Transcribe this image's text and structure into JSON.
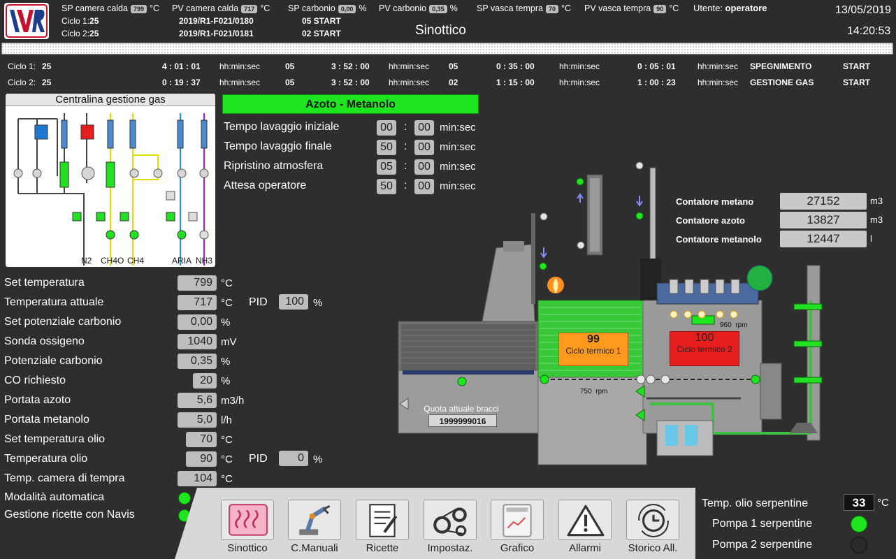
{
  "header": {
    "sp_camera_calda_label": "SP camera calda",
    "sp_camera_calda": "799",
    "sp_camera_calda_unit": "°C",
    "pv_camera_calda_label": "PV camera calda",
    "pv_camera_calda": "717",
    "pv_camera_calda_unit": "°C",
    "sp_carbonio_label": "SP carbonio",
    "sp_carbonio": "0,00",
    "sp_carbonio_unit": "%",
    "pv_carbonio_label": "PV carbonio",
    "pv_carbonio": "0,35",
    "pv_carbonio_unit": "%",
    "sp_vasca_label": "SP vasca tempra",
    "sp_vasca": "70",
    "sp_vasca_unit": "°C",
    "pv_vasca_label": "PV vasca tempra",
    "pv_vasca": "90",
    "pv_vasca_unit": "°C",
    "utente_label": "Utente:",
    "utente": "operatore",
    "date": "13/05/2019",
    "time": "14:20:53",
    "page_title": "Sinottico",
    "ciclo1_label": "Ciclo 1:",
    "ciclo1_num": "25",
    "ciclo1_code": "2019/R1-F021/0180",
    "ciclo1_step": "05  START",
    "ciclo2_label": "Ciclo 2:",
    "ciclo2_num": "25",
    "ciclo2_code": "2019/R1-F021/0181",
    "ciclo2_step": "02  START",
    "logo_text": "IVR"
  },
  "cycles": [
    {
      "label": "Ciclo 1:",
      "num": "25",
      "t1": "4 :  01 :  01",
      "u1": "hh:min:sec",
      "s1": "05",
      "t2": "3 :  52 :  00",
      "u2": "hh:min:sec",
      "s2": "05",
      "t3": "0 :  35 :  00",
      "u3": "hh:min:sec",
      "t4": "0 :  05 :  01",
      "u4": "hh:min:sec",
      "phase": "SPEGNIMENTO",
      "state": "START"
    },
    {
      "label": "Ciclo 2:",
      "num": "25",
      "t1": "0 :  19 :  37",
      "u1": "hh:min:sec",
      "s1": "05",
      "t2": "3 :  52 :  00",
      "u2": "hh:min:sec",
      "s2": "02",
      "t3": "1 :  15 :  00",
      "u3": "hh:min:sec",
      "t4": "1 :  00 :  23",
      "u4": "hh:min:sec",
      "phase": "GESTIONE GAS",
      "state": "START"
    }
  ],
  "gas_panel": {
    "title": "Centralina gestione gas",
    "lines": [
      "N2",
      "CH4O",
      "CH4",
      "ARIA",
      "NH3"
    ]
  },
  "gas_mode": "Azoto - Metanolo",
  "timers": [
    {
      "label": "Tempo lavaggio iniziale",
      "a": "00",
      "b": "00",
      "unit": "min:sec"
    },
    {
      "label": "Tempo lavaggio finale",
      "a": "50",
      "b": "00",
      "unit": "min:sec"
    },
    {
      "label": "Ripristino atmosfera",
      "a": "05",
      "b": "00",
      "unit": "min:sec"
    },
    {
      "label": "Attesa operatore",
      "a": "50",
      "b": "00",
      "unit": "min:sec"
    }
  ],
  "params": [
    {
      "label": "Set temperatura",
      "value": "799",
      "unit": "°C"
    },
    {
      "label": "Temperatura attuale",
      "value": "717",
      "unit": "°C"
    },
    {
      "label": "Set potenziale carbonio",
      "value": "0,00",
      "unit": "%"
    },
    {
      "label": "Sonda ossigeno",
      "value": "1040",
      "unit": "mV"
    },
    {
      "label": "Potenziale carbonio",
      "value": "0,35",
      "unit": "%"
    },
    {
      "label": "CO richiesto",
      "value": "20",
      "unit": "%"
    },
    {
      "label": "Portata azoto",
      "value": "5,6",
      "unit": "m3/h"
    },
    {
      "label": "Portata metanolo",
      "value": "5,0",
      "unit": "l/h"
    },
    {
      "label": "Set temperatura olio",
      "value": "70",
      "unit": "°C"
    },
    {
      "label": "Temperatura olio",
      "value": "90",
      "unit": "°C"
    },
    {
      "label": "Temp. camera di tempra",
      "value": "104",
      "unit": "°C"
    }
  ],
  "pid1": {
    "label": "PID",
    "value": "100",
    "unit": "%"
  },
  "pid2": {
    "label": "PID",
    "value": "0",
    "unit": "%"
  },
  "flags": [
    {
      "label": "Modalità automatica",
      "state": "on"
    },
    {
      "label": "Gestione ricette con Navis",
      "state": "on"
    }
  ],
  "counters": [
    {
      "label": "Contatore metano",
      "value": "27152",
      "unit": "m3"
    },
    {
      "label": "Contatore azoto",
      "value": "13827",
      "unit": "m3"
    },
    {
      "label": "Contatore metanolo",
      "value": "12447",
      "unit": "l"
    }
  ],
  "furnace": {
    "ciclo1_temp": "99",
    "ciclo1_label": "Ciclo termico 1",
    "ciclo2_temp": "100",
    "ciclo2_label": "Ciclo termico 2",
    "rpm1": "750",
    "rpm1_unit": "rpm",
    "rpm2": "960",
    "rpm2_unit": "rpm",
    "quota_label": "Quota attuale bracci",
    "quota_value": "1999999016"
  },
  "nav": [
    {
      "label": "Sinottico",
      "icon": "heater-icon"
    },
    {
      "label": "C.Manuali",
      "icon": "robot-arm-icon"
    },
    {
      "label": "Ricette",
      "icon": "recipe-icon"
    },
    {
      "label": "Impostaz.",
      "icon": "belts-icon"
    },
    {
      "label": "Grafico",
      "icon": "chart-icon"
    },
    {
      "label": "Allarmi",
      "icon": "warning-icon"
    },
    {
      "label": "Storico All.",
      "icon": "history-icon"
    }
  ],
  "serpentine": {
    "temp_label": "Temp. olio serpentine",
    "temp_value": "33",
    "temp_unit": "°C",
    "pompa1_label": "Pompa 1 serpentine",
    "pompa1_state": "on",
    "pompa2_label": "Pompa 2 serpentine",
    "pompa2_state": "off"
  },
  "colors": {
    "green": "#1ee61e",
    "orange": "#ff9a1e",
    "red": "#e61e1e",
    "panel": "#bdbdbd"
  }
}
